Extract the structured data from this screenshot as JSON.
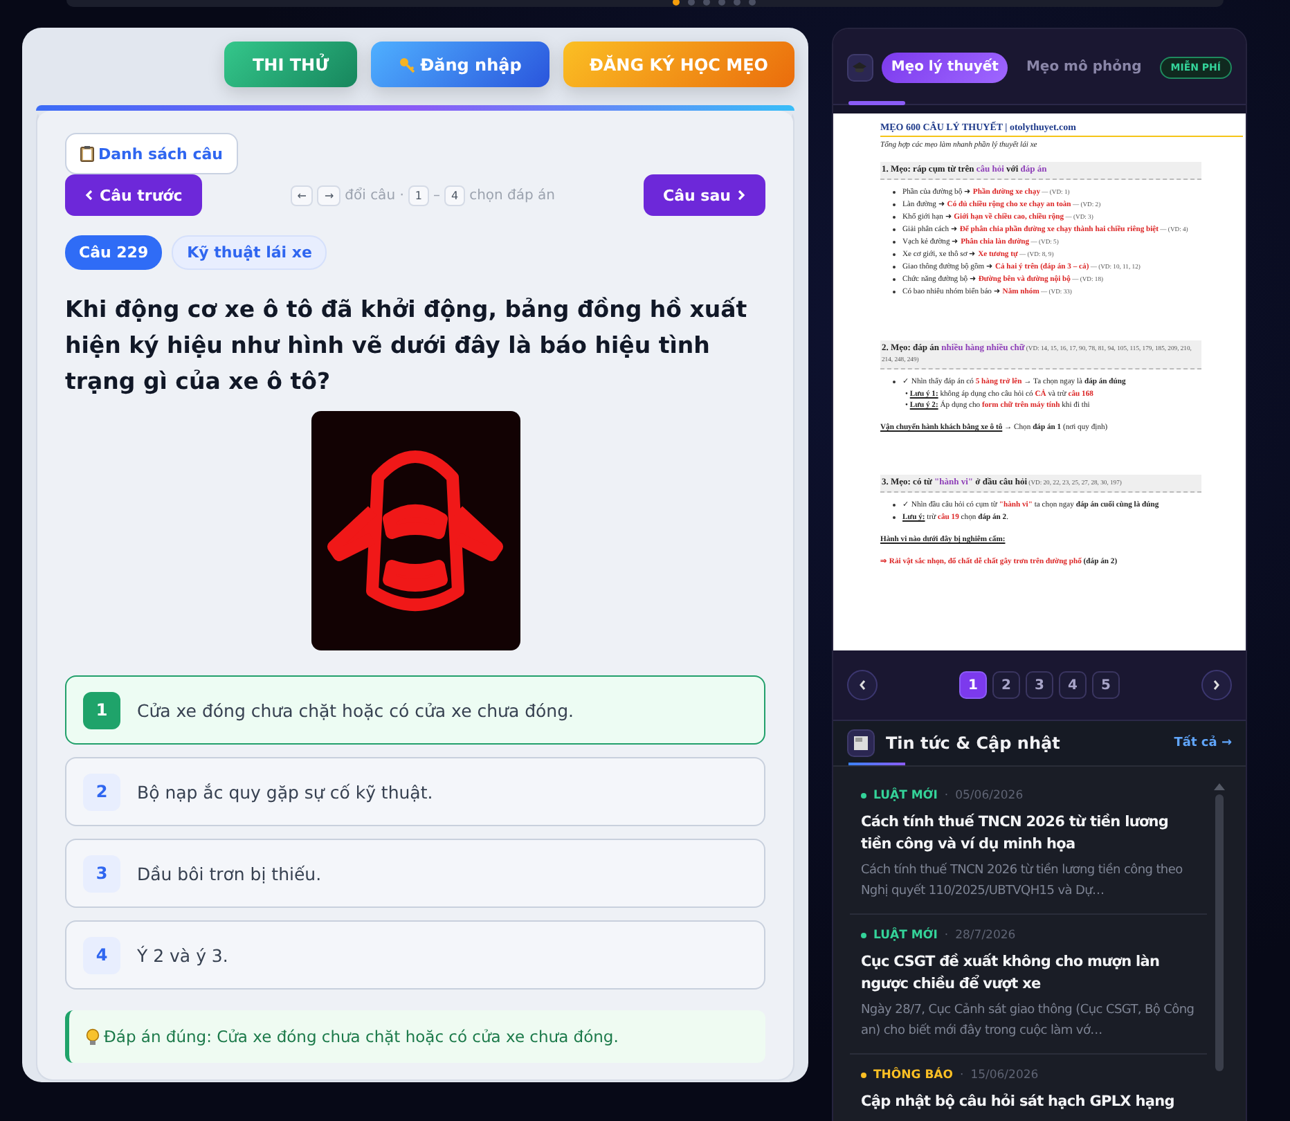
{
  "carousel_dots": [
    {
      "selected": true
    },
    {
      "selected": false
    },
    {
      "selected": false
    },
    {
      "selected": false
    },
    {
      "selected": false
    },
    {
      "selected": false
    }
  ],
  "top_buttons": [
    {
      "kind": "green",
      "label": "THI THỬ"
    },
    {
      "kind": "blue",
      "label": "Đăng nhập"
    },
    {
      "kind": "orange",
      "label": "ĐĂNG KÝ HỌC MẸO"
    }
  ],
  "question_list_button": {
    "label": "Danh sách câu"
  },
  "nav": {
    "prev": "Câu trước",
    "next": "Câu sau",
    "hint": [
      {
        "kind": "key",
        "text": "←"
      },
      {
        "kind": "key",
        "text": "→"
      },
      {
        "kind": "text",
        "text": "đổi câu ·"
      },
      {
        "kind": "key",
        "text": "1"
      },
      {
        "kind": "text",
        "text": "–"
      },
      {
        "kind": "key",
        "text": "4"
      },
      {
        "kind": "text",
        "text": "chọn đáp án"
      }
    ]
  },
  "question": {
    "number": "Câu 229",
    "topic": "Kỹ thuật lái xe",
    "text": "Khi động cơ xe ô tô đã khởi động, bảng đồng hồ xuất hiện ký hiệu như hình vẽ dưới đây là báo hiệu tình trạng gì của xe ô tô?"
  },
  "answers": [
    {
      "number": "1",
      "text": "Cửa xe đóng chưa chặt hoặc có cửa xe chưa đóng.",
      "selected": true
    },
    {
      "number": "2",
      "text": "Bộ nạp ắc quy gặp sự cố kỹ thuật.",
      "selected": false
    },
    {
      "number": "3",
      "text": "Dầu bôi trơn bị thiếu.",
      "selected": false
    },
    {
      "number": "4",
      "text": "Ý 2 và ý 3.",
      "selected": false
    }
  ],
  "correct_answer": "Đáp án đúng: Cửa xe đóng chưa chặt hoặc có cửa xe chưa đóng.",
  "tips_panel": {
    "tabs": [
      {
        "label": "Mẹo lý thuyết",
        "selected": true
      },
      {
        "label": "Mẹo mô phỏng",
        "selected": false
      }
    ],
    "badge": "MIỄN PHÍ",
    "document": [
      {
        "kind": "title",
        "parts": [
          {
            "text": "MẸO 600 CÂU LÝ THUYẾT"
          },
          {
            "text": " | otolythuyet.com"
          }
        ]
      },
      {
        "kind": "subtitle",
        "parts": [
          {
            "text": "Tổng hợp các mẹo làm nhanh phần lý thuyết lái xe"
          }
        ]
      },
      {
        "kind": "heading",
        "parts": [
          {
            "text": "1. Mẹo: ráp cụm từ trên "
          },
          {
            "text": "câu hỏi",
            "purple": true
          },
          {
            "text": " với "
          },
          {
            "text": "đáp án",
            "purple": true
          }
        ]
      },
      {
        "kind": "bullet",
        "parts": [
          {
            "text": "Phần của đường bộ ➜ "
          },
          {
            "text": "Phần đường xe chạy",
            "red": true
          },
          {
            "text": " — (VD: 1)",
            "small": true
          }
        ]
      },
      {
        "kind": "bullet",
        "parts": [
          {
            "text": "Làn đường ➜ "
          },
          {
            "text": "Có đủ chiều rộng cho xe chạy an toàn",
            "red": true
          },
          {
            "text": " — (VD: 2)",
            "small": true
          }
        ]
      },
      {
        "kind": "bullet",
        "parts": [
          {
            "text": "Khổ giới hạn ➜ "
          },
          {
            "text": "Giới hạn về chiều cao, chiều rộng",
            "red": true
          },
          {
            "text": " — (VD: 3)",
            "small": true
          }
        ]
      },
      {
        "kind": "bullet",
        "parts": [
          {
            "text": "Giải phân cách ➜ "
          },
          {
            "text": "Để phân chia phần đường xe chạy thành hai chiều riêng biệt",
            "red": true
          },
          {
            "text": " — (VD: 4)",
            "small": true
          }
        ]
      },
      {
        "kind": "bullet",
        "parts": [
          {
            "text": "Vạch kẻ đường ➜ "
          },
          {
            "text": "Phân chia làn đường",
            "red": true
          },
          {
            "text": " — (VD: 5)",
            "small": true
          }
        ]
      },
      {
        "kind": "bullet",
        "parts": [
          {
            "text": "Xe cơ giới, xe thô sơ ➜ "
          },
          {
            "text": "Xe tương tự",
            "red": true
          },
          {
            "text": " — (VD: 8, 9)",
            "small": true
          }
        ]
      },
      {
        "kind": "bullet",
        "parts": [
          {
            "text": "Giao thông đường bộ gồm ➜ "
          },
          {
            "text": "Cả hai ý trên (đáp án 3 – cả)",
            "red": true
          },
          {
            "text": " — (VD: 10, 11, 12)",
            "small": true
          }
        ]
      },
      {
        "kind": "bullet",
        "parts": [
          {
            "text": "Chức năng đường bộ ➜ "
          },
          {
            "text": "Đường bên và đường nội bộ",
            "red": true
          },
          {
            "text": " — (VD: 18)",
            "small": true
          }
        ]
      },
      {
        "kind": "bullet",
        "parts": [
          {
            "text": "Có bao nhiêu nhóm biển báo ➜ "
          },
          {
            "text": "Năm nhóm",
            "red": true
          },
          {
            "text": " — (VD: 33)",
            "small": true
          }
        ]
      },
      {
        "kind": "heading",
        "parts": [
          {
            "text": "2. Mẹo: đáp án "
          },
          {
            "text": "nhiều hàng nhiều chữ",
            "purple": true
          },
          {
            "text": " (VD: 14, 15, 16, 17, 90, 78, 81, 94, 105, 115, 179, 185, 209, 210, 214, 248, 249)",
            "small": true
          }
        ]
      },
      {
        "kind": "bullet",
        "parts": [
          {
            "text": "✓ Nhìn thấy đáp án có "
          },
          {
            "text": "5 hàng trở lên",
            "red": true
          },
          {
            "text": " → Ta chọn ngay là "
          },
          {
            "text": "đáp án đúng",
            "bold": true
          }
        ]
      },
      {
        "kind": "note",
        "parts": [
          {
            "text": "• "
          },
          {
            "text": "Lưu ý 1:",
            "underline": true
          },
          {
            "text": " không áp dụng cho câu hỏi có "
          },
          {
            "text": "CẢ",
            "red": true
          },
          {
            "text": " và trừ "
          },
          {
            "text": "câu 168",
            "red": true
          }
        ]
      },
      {
        "kind": "note",
        "parts": [
          {
            "text": "• "
          },
          {
            "text": "Lưu ý 2:",
            "underline": true
          },
          {
            "text": " Áp dụng cho "
          },
          {
            "text": "form chữ trên máy tính",
            "red": true
          },
          {
            "text": " khi đi thi"
          }
        ]
      },
      {
        "kind": "para",
        "parts": [
          {
            "text": "Vận chuyển hành khách bằng xe ô tô",
            "underline": true
          },
          {
            "text": "  → Chọn "
          },
          {
            "text": "đáp án 1",
            "bold": true
          },
          {
            "text": " (nơi quy định)"
          }
        ]
      },
      {
        "kind": "heading",
        "parts": [
          {
            "text": "3. Mẹo: có từ "
          },
          {
            "text": "\"hành vi\"",
            "purple": true
          },
          {
            "text": " ở đầu câu hỏi"
          },
          {
            "text": " (VD: 20, 22, 23, 25, 27, 28, 30, 197)",
            "small": true
          }
        ]
      },
      {
        "kind": "bullet",
        "parts": [
          {
            "text": "✓ Nhìn đầu câu hỏi có cụm từ "
          },
          {
            "text": "\"hành vi\"",
            "red": true
          },
          {
            "text": " ta chọn ngay "
          },
          {
            "text": "đáp án cuối cùng là đúng",
            "bold": true
          }
        ]
      },
      {
        "kind": "bullet",
        "parts": [
          {
            "text": "Lưu ý:",
            "underline": true
          },
          {
            "text": " trừ "
          },
          {
            "text": "câu 19",
            "red": true
          },
          {
            "text": " chọn "
          },
          {
            "text": "đáp án 2",
            "bold": true
          },
          {
            "text": "."
          }
        ]
      },
      {
        "kind": "para",
        "parts": [
          {
            "text": "Hành vi nào dưới đây bị nghiêm cấm:",
            "underline": true
          }
        ]
      },
      {
        "kind": "para",
        "parts": [
          {
            "text": "⇒ Rải vật sắc nhọn, đổ chất dễ chất gây trơn trên đường phố",
            "red": true
          },
          {
            "text": " (đáp án 2)",
            "bold": true
          }
        ]
      }
    ],
    "pages": [
      {
        "label": "1",
        "selected": true
      },
      {
        "label": "2",
        "selected": false
      },
      {
        "label": "3",
        "selected": false
      },
      {
        "label": "4",
        "selected": false
      },
      {
        "label": "5",
        "selected": false
      }
    ]
  },
  "news": {
    "title": "Tin tức & Cập nhật",
    "see_all": "Tất cả →",
    "items": [
      {
        "tag": "LUẬT MỚI",
        "color": "#34d399",
        "separator": "·",
        "date": "05/06/2026",
        "title": "Cách tính thuế TNCN 2026 từ tiền lương tiền công và ví dụ minh họa",
        "excerpt": "Cách tính thuế TNCN 2026 từ tiền lương tiền công theo Nghị quyết 110/2025/UBTVQH15 và Dự…"
      },
      {
        "tag": "LUẬT MỚI",
        "color": "#34d399",
        "separator": "·",
        "date": "28/7/2026",
        "title": "Cục CSGT đề xuất không cho mượn làn ngược chiều để vượt xe",
        "excerpt": "Ngày 28/7, Cục Cảnh sát giao thông (Cục CSGT, Bộ Công an) cho biết mới đây trong cuộc làm vớ…"
      },
      {
        "tag": "THÔNG BÁO",
        "color": "#fbbf24",
        "separator": "·",
        "date": "15/06/2026",
        "title": "Cập nhật bộ câu hỏi sát hạch GPLX hạng"
      }
    ]
  }
}
